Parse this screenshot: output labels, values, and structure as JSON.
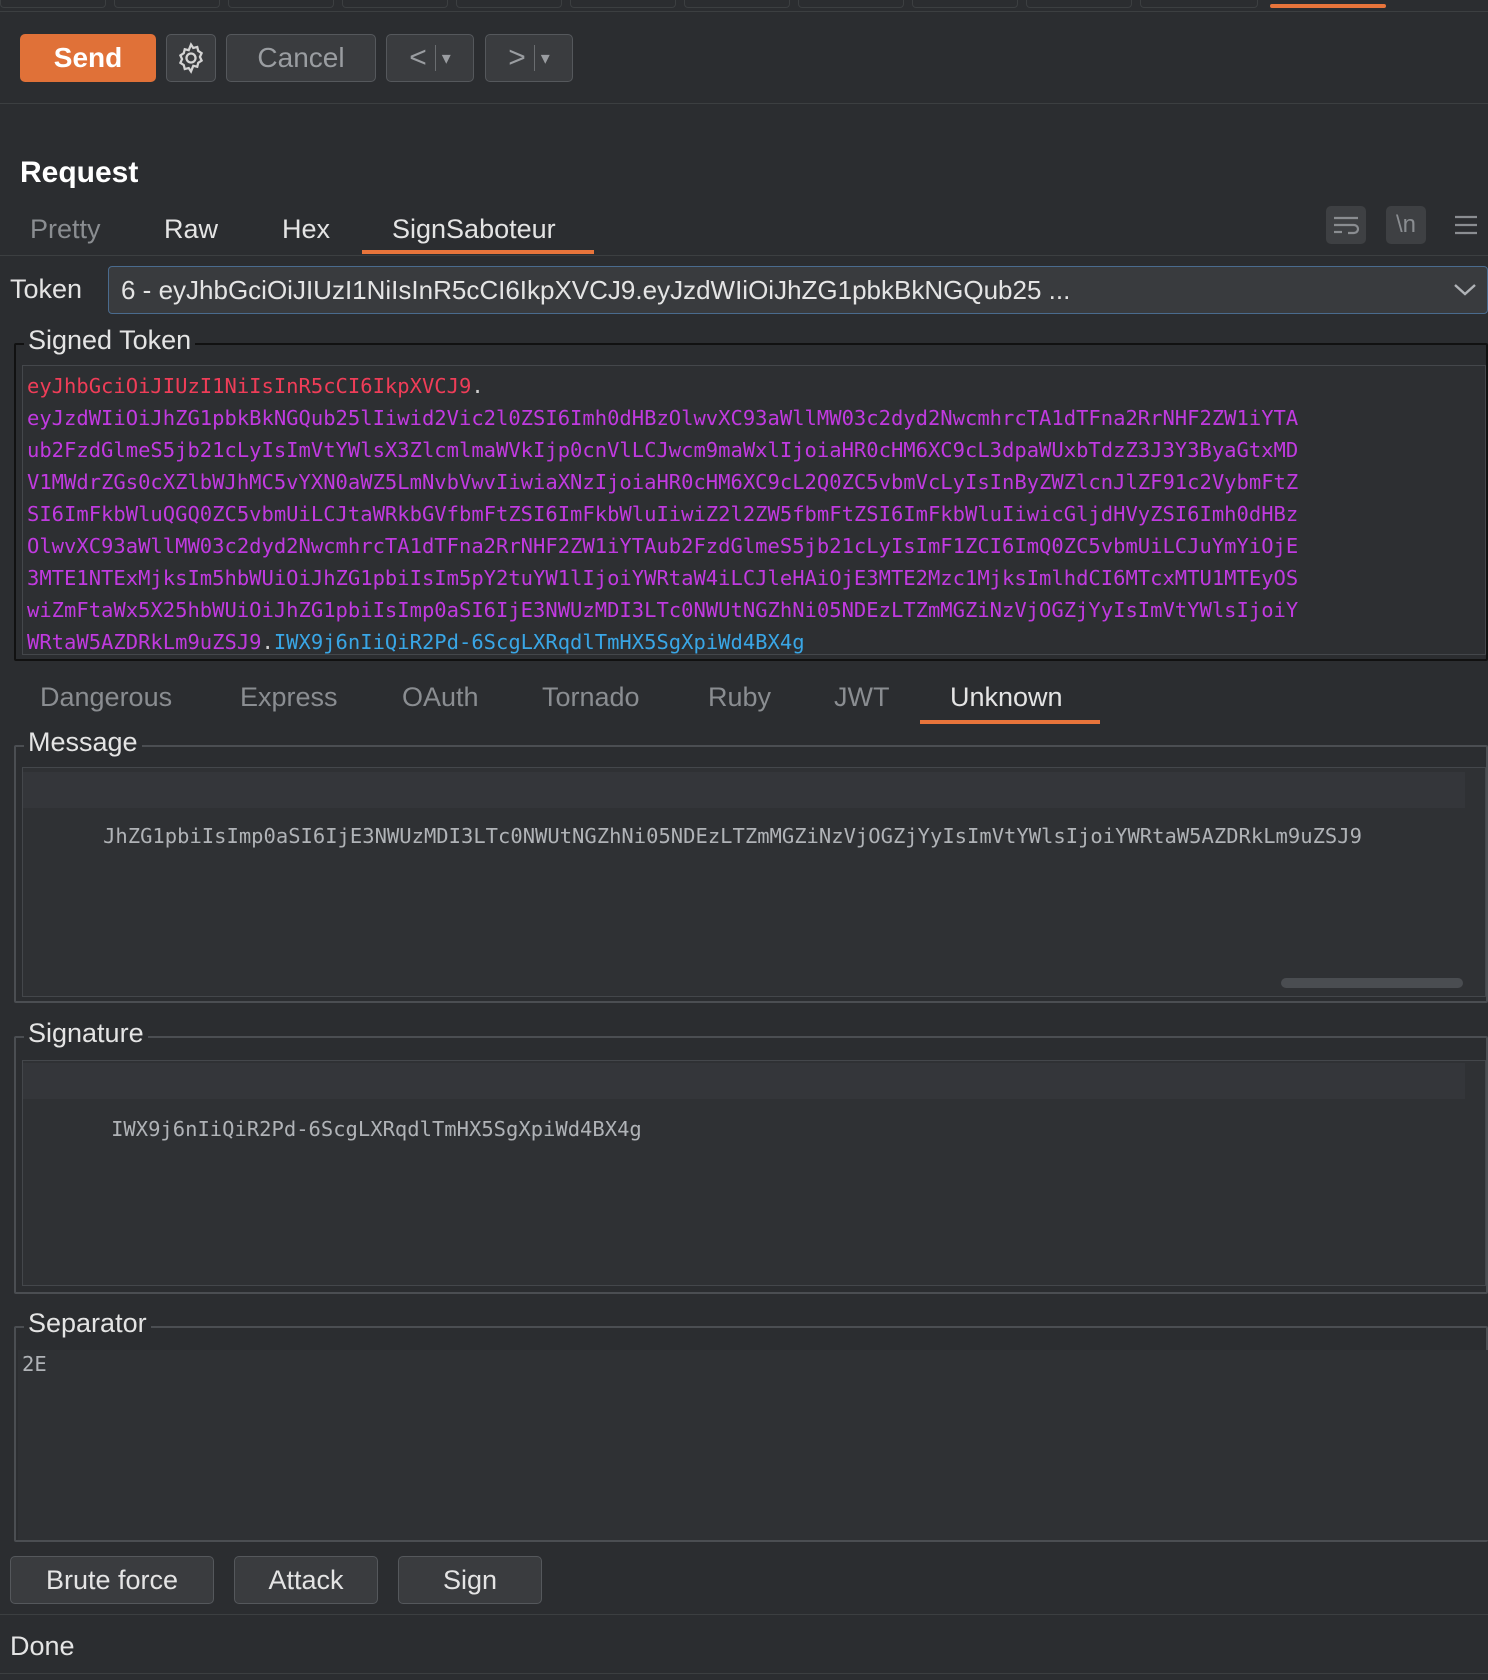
{
  "toolbar": {
    "send_label": "Send",
    "cancel_label": "Cancel",
    "back_arrow": "<",
    "forward_arrow": ">",
    "dropdown_glyph": "▾"
  },
  "request": {
    "title": "Request",
    "tabs": [
      {
        "label": "Pretty",
        "active": false
      },
      {
        "label": "Raw",
        "active": false
      },
      {
        "label": "Hex",
        "active": false
      },
      {
        "label": "SignSaboteur",
        "active": true
      }
    ],
    "right_icons": [
      "wrap-icon",
      "newline-icon",
      "menu-icon"
    ],
    "newline_glyph": "\\n"
  },
  "token": {
    "label": "Token",
    "selected": "6 - eyJhbGciOiJIUzI1NiIsInR5cCI6IkpXVCJ9.eyJzdWIiOiJhZG1pbkBkNGQub25 ..."
  },
  "signed_token": {
    "legend": "Signed Token",
    "header": "eyJhbGciOiJIUzI1NiIsInR5cCI6IkpXVCJ9",
    "dot1": ".",
    "payload_lines": [
      "eyJzdWIiOiJhZG1pbkBkNGQub25lIiwid2Vic2l0ZSI6Imh0dHBzOlwvXC93aWllMW03c2dyd2NwcmhrcTA1dTFna2RrNHF2ZW1iYTA",
      "ub2FzdGlmeS5jb21cLyIsImVtYWlsX3ZlcmlmaWVkIjp0cnVlLCJwcm9maWxlIjoiaHR0cHM6XC9cL3dpaWUxbTdzZ3J3Y3ByaGtxMD",
      "V1MWdrZGs0cXZlbWJhMC5vYXN0aWZ5LmNvbVwvIiwiaXNzIjoiaHR0cHM6XC9cL2Q0ZC5vbmVcLyIsInByZWZlcnJlZF91c2VybmFtZ",
      "SI6ImFkbWluQGQ0ZC5vbmUiLCJtaWRkbGVfbmFtZSI6ImFkbWluIiwiZ2l2ZW5fbmFtZSI6ImFkbWluIiwicGljdHVyZSI6Imh0dHBz",
      "OlwvXC93aWllMW03c2dyd2NwcmhrcTA1dTFna2RrNHF2ZW1iYTAub2FzdGlmeS5jb21cLyIsImF1ZCI6ImQ0ZC5vbmUiLCJuYmYiOjE",
      "3MTE1NTExMjksIm5hbWUiOiJhZG1pbiIsIm5pY2tuYW1lIjoiYWRtaW4iLCJleHAiOjE3MTE2Mzc1MjksImlhdCI6MTcxMTU1MTEyOS",
      "wiZmFtaWx5X25hbWUiOiJhZG1pbiIsImp0aSI6IjE3NWUzMDI3LTc0NWUtNGZhNi05NDEzLTZmMGZiNzVjOGZjYyIsImVtYWlsIjoiY",
      "WRtaW5AZDRkLm9uZSJ9"
    ],
    "dot2": ".",
    "signature": "IWX9j6nIiQiR2Pd-6ScgLXRqdlTmHX5SgXpiWd4BX4g"
  },
  "signer_tabs": [
    {
      "label": "Dangerous",
      "active": false
    },
    {
      "label": "Express",
      "active": false
    },
    {
      "label": "OAuth",
      "active": false
    },
    {
      "label": "Tornado",
      "active": false
    },
    {
      "label": "Ruby",
      "active": false
    },
    {
      "label": "JWT",
      "active": false
    },
    {
      "label": "Unknown",
      "active": true
    }
  ],
  "message": {
    "legend": "Message",
    "value": "JhZG1pbiIsImp0aSI6IjE3NWUzMDI3LTc0NWUtNGZhNi05NDEzLTZmMGZiNzVjOGZjYyIsImVtYWlsIjoiYWRtaW5AZDRkLm9uZSJ9"
  },
  "signature": {
    "legend": "Signature",
    "value": "IWX9j6nIiQiR2Pd-6ScgLXRqdlTmHX5SgXpiWd4BX4g"
  },
  "separator": {
    "legend": "Separator",
    "value": "2E"
  },
  "actions": {
    "brute_force": "Brute force",
    "attack": "Attack",
    "sign": "Sign"
  },
  "status": "Done",
  "colors": {
    "accent": "#e8743b",
    "send_button": "#e07138",
    "token_header": "#ef3d58",
    "token_payload": "#c13ae0",
    "token_signature": "#39a6e6"
  }
}
